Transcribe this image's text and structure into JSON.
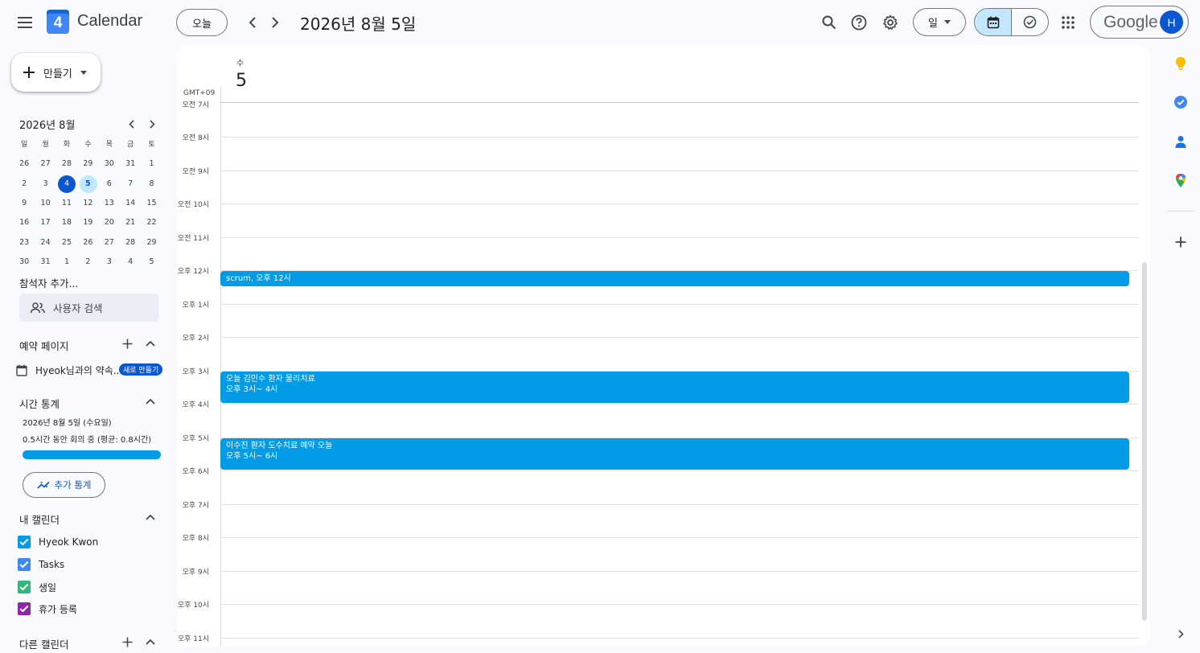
{
  "header": {
    "app_title": "Calendar",
    "logo_day": "4",
    "today_label": "오늘",
    "date_title": "2026년 8월 5일",
    "view_label": "일",
    "account_brand": "Google",
    "avatar_initial": "H"
  },
  "sidebar": {
    "create_label": "만들기",
    "mini_calendar": {
      "title": "2026년 8월",
      "weekdays": [
        "일",
        "월",
        "화",
        "수",
        "목",
        "금",
        "토"
      ],
      "weeks": [
        [
          "26",
          "27",
          "28",
          "29",
          "30",
          "31",
          "1"
        ],
        [
          "2",
          "3",
          "4",
          "5",
          "6",
          "7",
          "8"
        ],
        [
          "9",
          "10",
          "11",
          "12",
          "13",
          "14",
          "15"
        ],
        [
          "16",
          "17",
          "18",
          "19",
          "20",
          "21",
          "22"
        ],
        [
          "23",
          "24",
          "25",
          "26",
          "27",
          "28",
          "29"
        ],
        [
          "30",
          "31",
          "1",
          "2",
          "3",
          "4",
          "5"
        ]
      ],
      "today": "4",
      "selected": "5"
    },
    "meet_with": "참석자 추가...",
    "search_people_placeholder": "사용자 검색",
    "booking_pages": {
      "title": "예약 페이지",
      "item_label": "Hyeok님과의 약속...",
      "new_badge": "새로 만들기"
    },
    "time_insights": {
      "title": "시간 통계",
      "date": "2026년 8월 5일 (수요일)",
      "summary": "0.5시간 동안 회의 중 (평균: 0.8시간)",
      "more_label": "추가 통계"
    },
    "my_calendars": {
      "title": "내 캘린더",
      "items": [
        {
          "label": "Hyeok Kwon",
          "color": "#039be5"
        },
        {
          "label": "Tasks",
          "color": "#4285f4"
        },
        {
          "label": "생일",
          "color": "#33b679"
        },
        {
          "label": "휴가 등록",
          "color": "#8e24aa"
        }
      ]
    },
    "other_calendars": {
      "title": "다른 캘린더"
    }
  },
  "main": {
    "day_of_week": "수",
    "day_number": "5",
    "timezone": "GMT+09",
    "hour_labels": [
      "오전 7시",
      "오전 8시",
      "오전 9시",
      "오전 10시",
      "오전 11시",
      "오후 12시",
      "오후 1시",
      "오후 2시",
      "오후 3시",
      "오후 4시",
      "오후 5시",
      "오후 6시",
      "오후 7시",
      "오후 8시",
      "오후 9시",
      "오후 10시",
      "오후 11시"
    ],
    "events": [
      {
        "title": "scrum, 오후 12시",
        "time": ""
      },
      {
        "title": "오늘 김민수 환자 물리치료",
        "time": "오후 3시~ 4시"
      },
      {
        "title": "이수진 환자 도수치료 예약 오늘",
        "time": "오후 5시~ 6시"
      }
    ],
    "event_color": "#039be5"
  },
  "right_rail": {
    "icons": [
      "keep-icon",
      "tasks-icon",
      "contacts-icon",
      "maps-icon",
      "add-icon"
    ]
  }
}
